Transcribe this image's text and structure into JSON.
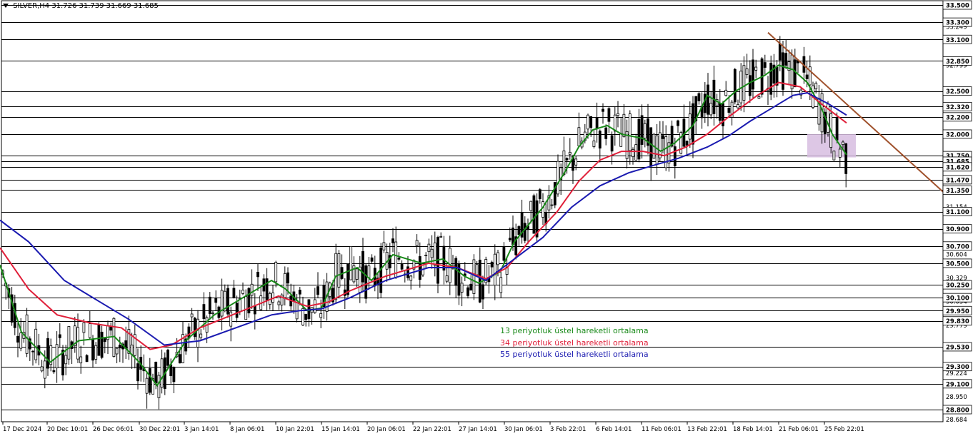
{
  "header": {
    "symbol": "SILVER,H4",
    "ohlc": "31.726 31.739 31.669 31.685"
  },
  "legend": [
    {
      "label": "13 periyotluk üstel hareketli ortalama",
      "color": "#1a8a1a"
    },
    {
      "label": "34 periyotluk üstel hareketli ortalama",
      "color": "#e0203a"
    },
    {
      "label": "55 periyotluk üstel hareketli ortalama",
      "color": "#1a1ab0"
    }
  ],
  "chart_data": {
    "type": "line",
    "subtype": "candlestick-with-moving-averages",
    "ylim": [
      28.684,
      33.5
    ],
    "grid": false,
    "y_ticks": [
      "33.500",
      "33.249",
      "33.100",
      "32.799",
      "32.500",
      "32.200",
      "32.000",
      "31.750",
      "31.620",
      "31.470",
      "31.350",
      "31.154",
      "31.100",
      "30.900",
      "30.700",
      "30.604",
      "30.500",
      "30.329",
      "30.250",
      "30.100",
      "30.054",
      "29.950",
      "29.830",
      "29.779",
      "29.530",
      "29.300",
      "29.224",
      "29.100",
      "28.950",
      "28.800",
      "28.684"
    ],
    "boxed_y_ticks": [
      "33.500",
      "33.300",
      "33.100",
      "32.850",
      "32.500",
      "32.320",
      "32.200",
      "32.000",
      "31.750",
      "31.685",
      "31.620",
      "31.470",
      "31.350",
      "31.100",
      "30.900",
      "30.700",
      "30.500",
      "30.250",
      "30.100",
      "29.950",
      "29.830",
      "29.530",
      "29.300",
      "29.100",
      "28.800"
    ],
    "horizontal_levels": [
      33.5,
      33.3,
      33.1,
      32.85,
      32.5,
      32.32,
      32.2,
      32.0,
      31.75,
      31.685,
      31.62,
      31.47,
      31.35,
      31.1,
      30.9,
      30.7,
      30.5,
      30.25,
      30.1,
      29.95,
      29.83,
      29.53,
      29.3,
      29.1,
      28.8
    ],
    "x_ticks": [
      "17 Dec 2024",
      "20 Dec 10:01",
      "26 Dec 06:01",
      "30 Dec 22:01",
      "3 Jan 14:01",
      "8 Jan 06:01",
      "10 Jan 22:01",
      "15 Jan 14:01",
      "20 Jan 06:01",
      "22 Jan 22:01",
      "27 Jan 14:01",
      "30 Jan 06:01",
      "3 Feb 22:01",
      "6 Feb 14:01",
      "11 Feb 06:01",
      "13 Feb 22:01",
      "18 Feb 14:01",
      "21 Feb 06:01",
      "25 Feb 22:01"
    ],
    "series": [
      {
        "name": "13 periyotluk üstel hareketli ortalama",
        "points": [
          [
            0,
            30.48
          ],
          [
            30,
            29.7
          ],
          [
            70,
            29.35
          ],
          [
            110,
            29.6
          ],
          [
            160,
            29.65
          ],
          [
            195,
            29.35
          ],
          [
            220,
            29.08
          ],
          [
            260,
            29.6
          ],
          [
            300,
            29.9
          ],
          [
            340,
            30.1
          ],
          [
            380,
            30.3
          ],
          [
            400,
            30.2
          ],
          [
            430,
            29.95
          ],
          [
            450,
            29.98
          ],
          [
            470,
            30.35
          ],
          [
            500,
            30.45
          ],
          [
            520,
            30.3
          ],
          [
            550,
            30.6
          ],
          [
            590,
            30.5
          ],
          [
            620,
            30.55
          ],
          [
            650,
            30.35
          ],
          [
            670,
            30.27
          ],
          [
            700,
            30.4
          ],
          [
            720,
            30.75
          ],
          [
            760,
            31.15
          ],
          [
            790,
            31.55
          ],
          [
            810,
            31.85
          ],
          [
            830,
            32.05
          ],
          [
            850,
            32.1
          ],
          [
            870,
            32.0
          ],
          [
            900,
            31.95
          ],
          [
            925,
            31.8
          ],
          [
            945,
            31.9
          ],
          [
            970,
            32.1
          ],
          [
            990,
            32.45
          ],
          [
            1010,
            32.35
          ],
          [
            1030,
            32.5
          ],
          [
            1050,
            32.6
          ],
          [
            1070,
            32.68
          ],
          [
            1090,
            32.8
          ],
          [
            1110,
            32.75
          ],
          [
            1130,
            32.6
          ],
          [
            1150,
            32.3
          ],
          [
            1165,
            32.0
          ],
          [
            1185,
            31.76
          ]
        ]
      },
      {
        "name": "34 periyotluk üstel hareketli ortalama",
        "points": [
          [
            0,
            30.68
          ],
          [
            40,
            30.2
          ],
          [
            80,
            29.9
          ],
          [
            130,
            29.8
          ],
          [
            170,
            29.75
          ],
          [
            210,
            29.5
          ],
          [
            240,
            29.55
          ],
          [
            280,
            29.75
          ],
          [
            340,
            29.95
          ],
          [
            390,
            30.12
          ],
          [
            430,
            30.0
          ],
          [
            460,
            30.05
          ],
          [
            490,
            30.18
          ],
          [
            540,
            30.35
          ],
          [
            600,
            30.5
          ],
          [
            640,
            30.45
          ],
          [
            680,
            30.32
          ],
          [
            710,
            30.45
          ],
          [
            740,
            30.75
          ],
          [
            780,
            31.1
          ],
          [
            810,
            31.45
          ],
          [
            840,
            31.7
          ],
          [
            870,
            31.8
          ],
          [
            900,
            31.8
          ],
          [
            930,
            31.75
          ],
          [
            960,
            31.85
          ],
          [
            990,
            32.0
          ],
          [
            1020,
            32.2
          ],
          [
            1060,
            32.45
          ],
          [
            1090,
            32.6
          ],
          [
            1120,
            32.55
          ],
          [
            1150,
            32.35
          ],
          [
            1185,
            32.13
          ]
        ]
      },
      {
        "name": "55 periyotluk üstel hareketli ortalama",
        "points": [
          [
            0,
            31.0
          ],
          [
            40,
            30.75
          ],
          [
            90,
            30.3
          ],
          [
            140,
            30.05
          ],
          [
            180,
            29.85
          ],
          [
            230,
            29.55
          ],
          [
            280,
            29.6
          ],
          [
            330,
            29.75
          ],
          [
            380,
            29.9
          ],
          [
            420,
            29.95
          ],
          [
            450,
            29.97
          ],
          [
            490,
            30.1
          ],
          [
            540,
            30.3
          ],
          [
            600,
            30.45
          ],
          [
            640,
            30.45
          ],
          [
            680,
            30.3
          ],
          [
            720,
            30.55
          ],
          [
            760,
            30.8
          ],
          [
            800,
            31.15
          ],
          [
            840,
            31.4
          ],
          [
            880,
            31.55
          ],
          [
            920,
            31.65
          ],
          [
            950,
            31.72
          ],
          [
            990,
            31.85
          ],
          [
            1020,
            31.98
          ],
          [
            1050,
            32.15
          ],
          [
            1080,
            32.3
          ],
          [
            1110,
            32.45
          ],
          [
            1130,
            32.48
          ],
          [
            1160,
            32.35
          ],
          [
            1185,
            32.22
          ]
        ]
      }
    ],
    "trendline": {
      "color": "#a0522d",
      "from": [
        1075,
        33.18
      ],
      "to": [
        1320,
        31.33
      ]
    },
    "zone": {
      "x_from": 1130,
      "x_to": 1198,
      "y_from": 32.0,
      "y_to": 31.73,
      "color": "#d7bde0"
    }
  }
}
